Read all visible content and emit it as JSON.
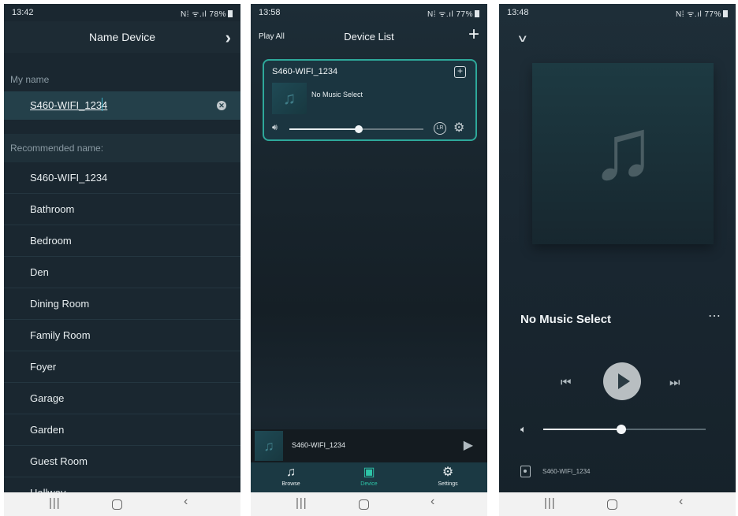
{
  "panel1": {
    "status": {
      "time": "13:42",
      "signal": "N⁞ ᯤ.ıl",
      "battery": "78%"
    },
    "header": {
      "title": "Name Device",
      "next_icon": "chevron-right-icon"
    },
    "my_name_label": "My name",
    "name_input": {
      "value": "S460-WIFI_1234"
    },
    "recommended_label": "Recommended name:",
    "recommended_names": [
      "S460-WIFI_1234",
      "Bathroom",
      "Bedroom",
      "Den",
      "Dining Room",
      "Family Room",
      "Foyer",
      "Garage",
      "Garden",
      "Guest Room",
      "Hallway"
    ]
  },
  "panel2": {
    "status": {
      "time": "13:58",
      "signal": "N⁞ ᯤ.ıl",
      "battery": "77%"
    },
    "header": {
      "play_all": "Play All",
      "title": "Device List"
    },
    "device_card": {
      "name": "S460-WIFI_1234",
      "track": "No Music Select",
      "volume": 0.52,
      "lr_label": "LR"
    },
    "mini_player": {
      "title": "S460-WIFI_1234"
    },
    "tabs": [
      {
        "label": "Browse",
        "icon": "music-note-icon",
        "active": false
      },
      {
        "label": "Device",
        "icon": "speaker-icon",
        "active": true
      },
      {
        "label": "Settings",
        "icon": "gear-icon",
        "active": false
      }
    ]
  },
  "panel3": {
    "status": {
      "time": "13:48",
      "signal": "N⁞ ᯤ.ıl",
      "battery": "77%"
    },
    "song_title": "No Music Select",
    "volume": 0.48,
    "device_name": "S460-WIFI_1234"
  },
  "colors": {
    "accent": "#2ec4a8",
    "card_border": "#2ea89a",
    "background": "#1a2730"
  }
}
